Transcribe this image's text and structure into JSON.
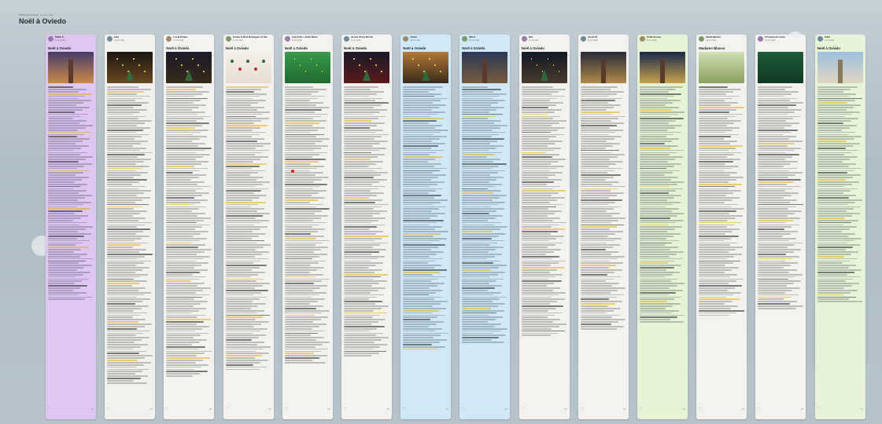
{
  "page": {
    "breadcrumb": "Padlet de la classe · il y a 1 mois",
    "title": "Noël à Oviedo"
  },
  "columns": [
    {
      "author": "Pablo F.",
      "sub": "Il y a 1 mois",
      "title": "Noël à Oviedo",
      "bg": "#e0c6f2",
      "img": "cathedral"
    },
    {
      "author": "Inés",
      "sub": "Il y a 1 mois",
      "title": "",
      "bg": "#f3f1ee",
      "img": "market"
    },
    {
      "author": "Lucía Peláez",
      "sub": "Il y a 1 mois",
      "title": "Noël à Oviedo",
      "bg": "#f5f3ef",
      "img": "treeNight"
    },
    {
      "author": "Tomás & Ruiz Rodriguez et Ste",
      "sub": "Il y a 1 mois",
      "title": "Noël à Oviedo",
      "bg": "#f4f2ee",
      "img": "ornaments"
    },
    {
      "author": "Ana Félix + Sofía Nieve",
      "sub": "Il y a 1 mois",
      "title": "Noël à Oviedo",
      "bg": "#f4f2ee",
      "img": "green"
    },
    {
      "author": "Jessel Pérez Bernat",
      "sub": "Il y a 1 mois",
      "title": "Noël à Oviedo",
      "bg": "#f4f2ee",
      "img": "bigTree"
    },
    {
      "author": "Yoana",
      "sub": "Il y a 1 mois",
      "title": "Noël à Oviedo",
      "bg": "#cfe9f8",
      "img": "lights"
    },
    {
      "author": "Mario",
      "sub": "Il y a 1 mois",
      "title": "Noël à Oviedo",
      "bg": "#cfe9f8",
      "img": "tower"
    },
    {
      "author": "Elia",
      "sub": "Il y a 1 mois",
      "title": "Noël à Oviedo",
      "bg": "#f4f2ee",
      "img": "night"
    },
    {
      "author": "Jacob M.",
      "sub": "Il y a 1 mois",
      "title": "",
      "bg": "#f4f2ee",
      "img": "street"
    },
    {
      "author": "Sofía Arenas",
      "sub": "Il y a 1 mois",
      "title": "",
      "bg": "#e6f4d6",
      "img": "street2"
    },
    {
      "author": "Nadia Blanco",
      "sub": "Il y a 1 mois",
      "title": "Madame Blanco",
      "bg": "#f4f2ee",
      "img": "santa"
    },
    {
      "author": "Filomena & Laura",
      "sub": "Il y a 1 mois",
      "title": "",
      "bg": "#f4f2ee",
      "img": "banner"
    },
    {
      "author": "Sofía",
      "sub": "Il y a 1 mois",
      "title": "Noël à Oviedo",
      "bg": "#e8f4d8",
      "img": "towerDay"
    }
  ]
}
